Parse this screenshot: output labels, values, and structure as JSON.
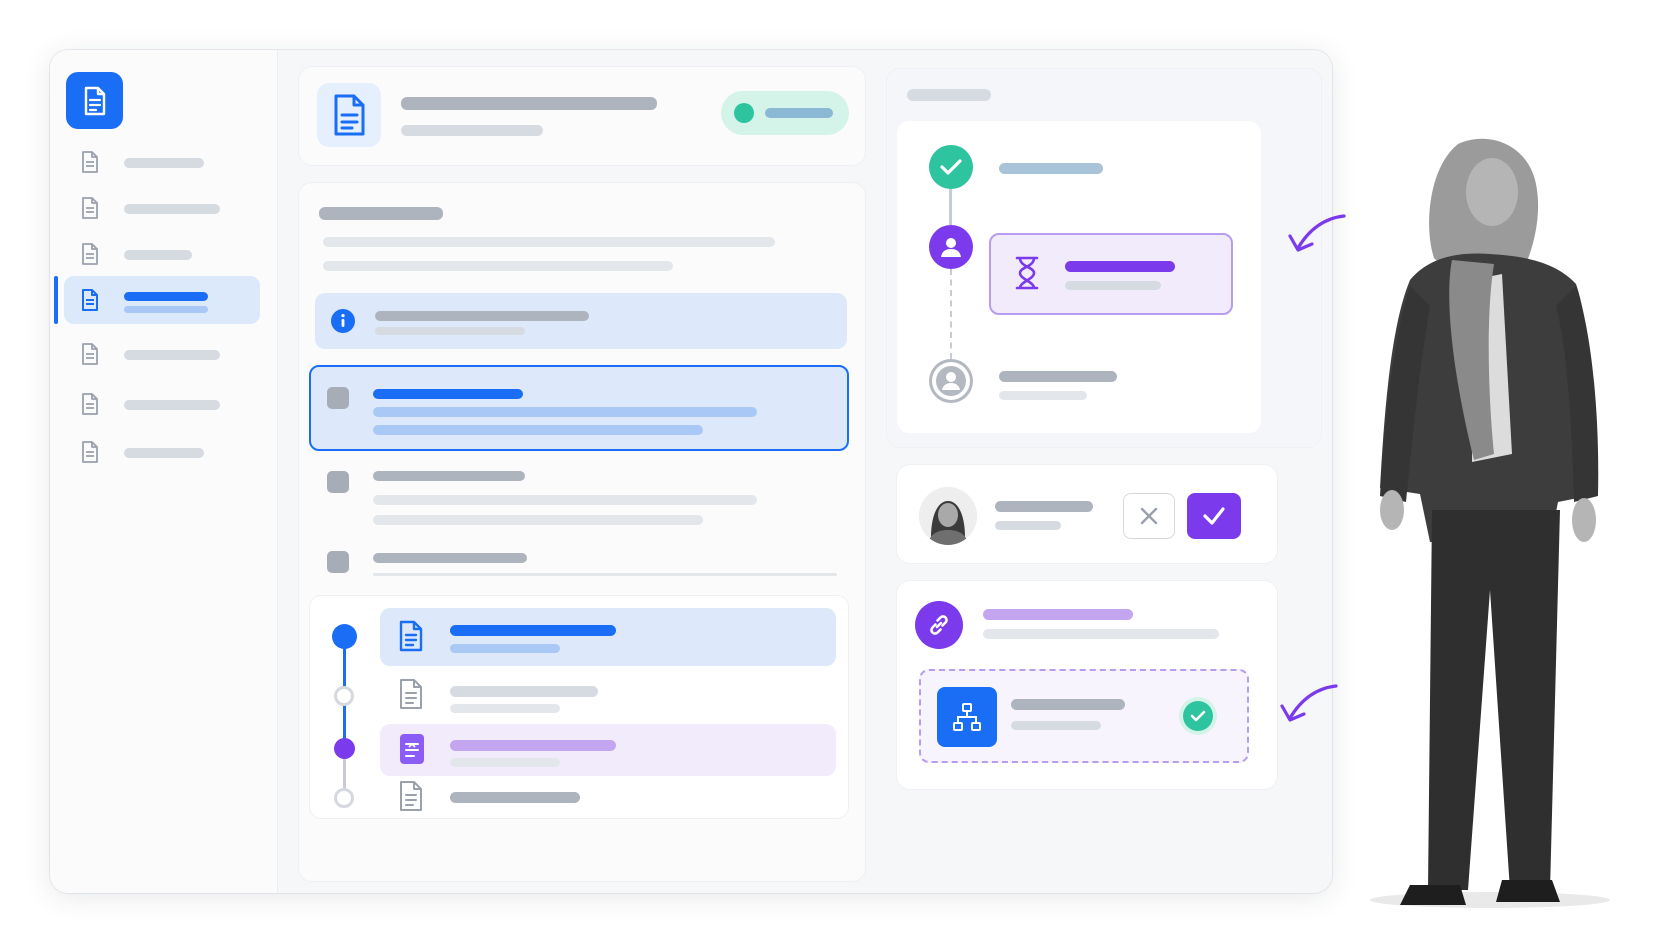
{
  "colors": {
    "primary": "#1a6ef5",
    "accent_purple": "#7c3aed",
    "success_teal": "#2ec4a0",
    "gray_icon": "#9aa1ab"
  },
  "icons": {
    "logo": "document-icon",
    "nav": "document-icon",
    "status": "dot-icon",
    "info": "info-icon",
    "approved": "check-circle-icon",
    "current_step": "user-icon",
    "pending": "hourglass-icon",
    "future_step": "user-icon",
    "reject": "close-icon",
    "approve": "check-icon",
    "link": "link-icon",
    "workflow": "hierarchy-icon"
  },
  "sidebar": {
    "items": [
      {
        "id": "nav-1",
        "active": false
      },
      {
        "id": "nav-2",
        "active": false
      },
      {
        "id": "nav-3",
        "active": false
      },
      {
        "id": "nav-4",
        "active": true
      },
      {
        "id": "nav-5",
        "active": false
      },
      {
        "id": "nav-6",
        "active": false
      },
      {
        "id": "nav-7",
        "active": false
      }
    ]
  },
  "approval_steps": [
    {
      "state": "approved"
    },
    {
      "state": "pending"
    },
    {
      "state": "upcoming"
    }
  ],
  "timeline": [
    {
      "state": "current"
    },
    {
      "state": "upcoming"
    },
    {
      "state": "active-purple"
    },
    {
      "state": "upcoming"
    }
  ]
}
